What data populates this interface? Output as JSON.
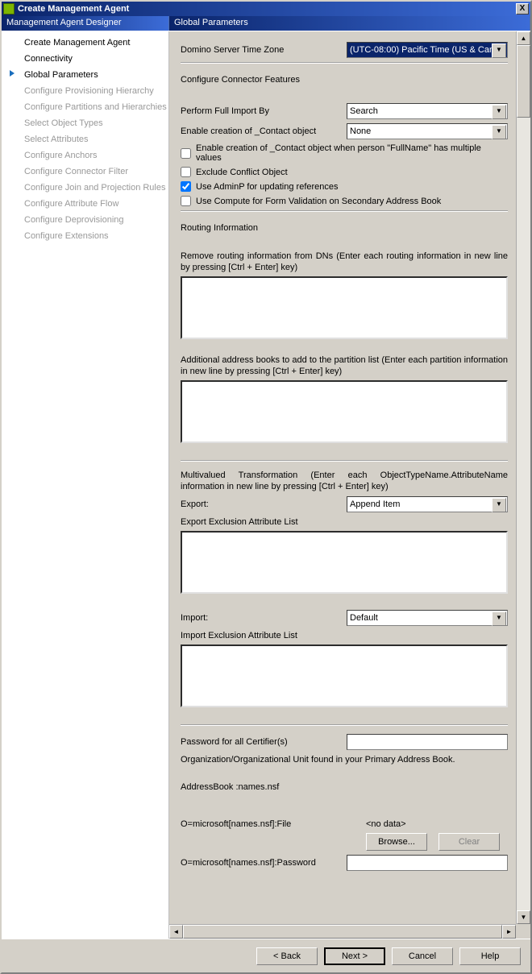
{
  "window": {
    "title": "Create Management Agent"
  },
  "columns": {
    "left": "Management Agent Designer",
    "right": "Global Parameters"
  },
  "nav": {
    "items": [
      {
        "label": "Create Management Agent",
        "state": "done"
      },
      {
        "label": "Connectivity",
        "state": "done"
      },
      {
        "label": "Global Parameters",
        "state": "current"
      },
      {
        "label": "Configure Provisioning Hierarchy",
        "state": "pending"
      },
      {
        "label": "Configure Partitions and Hierarchies",
        "state": "pending"
      },
      {
        "label": "Select Object Types",
        "state": "pending"
      },
      {
        "label": "Select Attributes",
        "state": "pending"
      },
      {
        "label": "Configure Anchors",
        "state": "pending"
      },
      {
        "label": "Configure Connector Filter",
        "state": "pending"
      },
      {
        "label": "Configure Join and Projection Rules",
        "state": "pending"
      },
      {
        "label": "Configure Attribute Flow",
        "state": "pending"
      },
      {
        "label": "Configure Deprovisioning",
        "state": "pending"
      },
      {
        "label": "Configure Extensions",
        "state": "pending"
      }
    ]
  },
  "form": {
    "timezone_label": "Domino Server Time Zone",
    "timezone_value": "(UTC-08:00) Pacific Time (US & Can",
    "connector_features_title": "Configure Connector Features",
    "perform_full_import_label": "Perform Full Import By",
    "perform_full_import_value": "Search",
    "enable_creation_label": "Enable creation of _Contact object",
    "enable_creation_value": "None",
    "cb_enable_creation_fullname": "Enable creation of _Contact object when person \"FullName\" has multiple values",
    "cb_exclude_conflict": "Exclude Conflict Object",
    "cb_use_adminp": "Use AdminP for updating references",
    "cb_use_compute": "Use Compute for Form Validation on Secondary Address Book",
    "routing_title": "Routing Information",
    "routing_desc": "Remove routing information from DNs (Enter each routing information in new line by pressing [Ctrl + Enter] key)",
    "addbooks_desc": "Additional address books to add to the partition list (Enter each partition information in new line by pressing [Ctrl + Enter] key)",
    "multivalued_desc": "Multivalued Transformation (Enter each ObjectTypeName.AttributeName information in new line by pressing [Ctrl + Enter] key)",
    "export_label": "Export:",
    "export_value": "Append Item",
    "export_excl_label": "Export Exclusion Attribute List",
    "import_label": "Import:",
    "import_value": "Default",
    "import_excl_label": "Import Exclusion Attribute List",
    "password_label": "Password for all Certifier(s)",
    "password_value": "",
    "org_unit_text": "Organization/Organizational Unit found in your Primary Address Book.",
    "address_book_text": "AddressBook :names.nsf",
    "file_label": "O=microsoft[names.nsf]:File",
    "file_value": "<no data>",
    "browse_btn": "Browse...",
    "clear_btn": "Clear",
    "pw2_label": "O=microsoft[names.nsf]:Password",
    "pw2_value": ""
  },
  "footer": {
    "back": "< Back",
    "next": "Next >",
    "cancel": "Cancel",
    "help": "Help"
  }
}
